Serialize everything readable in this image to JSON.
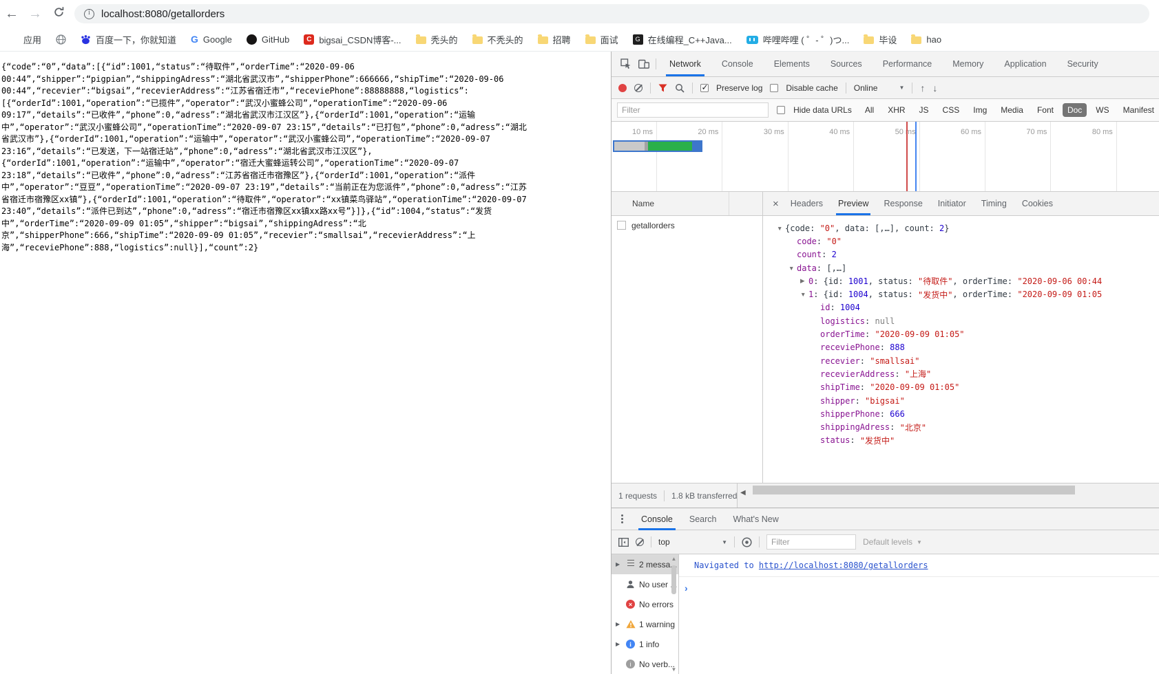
{
  "colors": {
    "accent_blue": "#1a73e8",
    "record_red": "#e04343",
    "filter_funnel_red": "#d93025",
    "waterfall_green": "#2ab04a",
    "waterfall_gray": "#c9c9c9",
    "waterfall_selection_blue": "#3d76cc",
    "timeline_marker_red": "#d04a4a",
    "timeline_marker_blue": "#4585f0",
    "json_key_purple": "#881391",
    "json_string_red": "#c41a16",
    "json_number_blue": "#1c00cf",
    "json_null_gray": "#808080",
    "console_link_blue": "#2a53cd",
    "folder_yellow": "#f8d775",
    "doc_pill_gray": "#757575"
  },
  "browser": {
    "url": "localhost:8080/getallorders",
    "bookmarks": [
      {
        "icon": "apps",
        "label": "应用"
      },
      {
        "icon": "globe",
        "label": ""
      },
      {
        "icon": "baidu",
        "label": "百度一下，你就知道"
      },
      {
        "icon": "google",
        "label": "Google"
      },
      {
        "icon": "github",
        "label": "GitHub"
      },
      {
        "icon": "csdn",
        "label": "bigsai_CSDN博客-..."
      },
      {
        "icon": "folder",
        "label": "秃头的"
      },
      {
        "icon": "folder",
        "label": "不秃头的"
      },
      {
        "icon": "folder",
        "label": "招聘"
      },
      {
        "icon": "folder",
        "label": "面试"
      },
      {
        "icon": "code-site",
        "label": "在线编程_C++Java..."
      },
      {
        "icon": "bili",
        "label": "哔哩哔哩 ( ゜- ゜)つ..."
      },
      {
        "icon": "folder",
        "label": "毕设"
      },
      {
        "icon": "folder",
        "label": "hao"
      }
    ]
  },
  "page": {
    "lines": [
      "{“code”:“0”,“data”:[{“id”:1001,“status”:“待取件”,“orderTime”:“2020-09-06",
      "00:44”,“shipper”:“pigpian”,“shippingAdress”:“湖北省武汉市”,“shipperPhone”:666666,“shipTime”:“2020-09-06",
      "00:44”,“recevier”:“bigsai”,“recevierAddress”:“江苏省宿迁市”,“receviePhone”:88888888,“logistics”:",
      "[{“orderId”:1001,“operation”:“已揽件”,“operator”:“武汉小蜜蜂公司”,“operationTime”:“2020-09-06",
      "09:17”,“details”:“已收件”,“phone”:0,“adress”:“湖北省武汉市江汉区”},{“orderId”:1001,“operation”:“运输",
      "中”,“operator”:“武汉小蜜蜂公司”,“operationTime”:“2020-09-07 23:15”,“details”:“已打包”,“phone”:0,“adress”:“湖北",
      "省武汉市”},{“orderId”:1001,“operation”:“运输中”,“operator”:“武汉小蜜蜂公司”,“operationTime”:“2020-09-07",
      "23:16”,“details”:“已发送，下一站宿迁站”,“phone”:0,“adress”:“湖北省武汉市江汉区”},",
      "{“orderId”:1001,“operation”:“运输中”,“operator”:“宿迁大蜜蜂运转公司”,“operationTime”:“2020-09-07",
      "23:18”,“details”:“已收件”,“phone”:0,“adress”:“江苏省宿迁市宿豫区”},{“orderId”:1001,“operation”:“派件",
      "中”,“operator”:“豆豆”,“operationTime”:“2020-09-07 23:19”,“details”:“当前正在为您派件”,“phone”:0,“adress”:“江苏",
      "省宿迁市宿豫区xx镇”},{“orderId”:1001,“operation”:“待取件”,“operator”:“xx镇菜鸟驿站”,“operationTime”:“2020-09-07",
      "23:40”,“details”:“派件已到达”,“phone”:0,“adress”:“宿迁市宿豫区xx镇xx路xx号”}]},{“id”:1004,“status”:“发货",
      "中”,“orderTime”:“2020-09-09 01:05”,“shipper”:“bigsai”,“shippingAdress”:“北",
      "京”,“shipperPhone”:666,“shipTime”:“2020-09-09 01:05”,“recevier”:“smallsai”,“recevierAddress”:“上",
      "海”,“receviePhone”:888,“logistics”:null}],“count”:2}"
    ]
  },
  "devtools": {
    "tabs": [
      "Network",
      "Console",
      "Elements",
      "Sources",
      "Performance",
      "Memory",
      "Application",
      "Security"
    ],
    "active_tab": "Network",
    "network": {
      "toolbar": {
        "preserve_log": "Preserve log",
        "disable_cache": "Disable cache",
        "throttling": "Online"
      },
      "filter_placeholder": "Filter",
      "hide_data_urls": "Hide data URLs",
      "filters": [
        "All",
        "XHR",
        "JS",
        "CSS",
        "Img",
        "Media",
        "Font",
        "Doc",
        "WS",
        "Manifest"
      ],
      "active_filter": "Doc",
      "timeline_ticks": [
        "10 ms",
        "20 ms",
        "30 ms",
        "40 ms",
        "50 ms",
        "60 ms",
        "70 ms",
        "80 ms"
      ],
      "name_header": "Name",
      "requests": [
        "getallorders"
      ],
      "detail_tabs": [
        "Headers",
        "Preview",
        "Response",
        "Initiator",
        "Timing",
        "Cookies"
      ],
      "active_detail_tab": "Preview",
      "status": {
        "requests": "1 requests",
        "transferred": "1.8 kB transferred"
      }
    },
    "preview_rows": [
      {
        "i": 0,
        "a": "v",
        "s": [
          [
            "{code: ",
            "p"
          ],
          [
            "\"0\"",
            "s"
          ],
          [
            ", data: ",
            "p"
          ],
          [
            "[,…]",
            "p"
          ],
          [
            ", count: ",
            "p"
          ],
          [
            "2",
            "n"
          ],
          [
            "}",
            "p"
          ]
        ]
      },
      {
        "i": 1,
        "a": null,
        "s": [
          [
            "code",
            "k"
          ],
          [
            ": ",
            "p"
          ],
          [
            "\"0\"",
            "s"
          ]
        ]
      },
      {
        "i": 1,
        "a": null,
        "s": [
          [
            "count",
            "k"
          ],
          [
            ": ",
            "p"
          ],
          [
            "2",
            "n"
          ]
        ]
      },
      {
        "i": 1,
        "a": "v",
        "s": [
          [
            "data",
            "k"
          ],
          [
            ": ",
            "p"
          ],
          [
            "[,…]",
            "p"
          ]
        ]
      },
      {
        "i": 2,
        "a": "r",
        "s": [
          [
            "0",
            "k"
          ],
          [
            ": {id: ",
            "p"
          ],
          [
            "1001",
            "n"
          ],
          [
            ", status: ",
            "p"
          ],
          [
            "\"待取件\"",
            "s"
          ],
          [
            ", orderTime: ",
            "p"
          ],
          [
            "\"2020-09-06 00:44",
            "s"
          ]
        ]
      },
      {
        "i": 2,
        "a": "v",
        "s": [
          [
            "1",
            "k"
          ],
          [
            ": {id: ",
            "p"
          ],
          [
            "1004",
            "n"
          ],
          [
            ", status: ",
            "p"
          ],
          [
            "\"发货中\"",
            "s"
          ],
          [
            ", orderTime: ",
            "p"
          ],
          [
            "\"2020-09-09 01:05",
            "s"
          ]
        ]
      },
      {
        "i": 3,
        "a": null,
        "s": [
          [
            "id",
            "k"
          ],
          [
            ": ",
            "p"
          ],
          [
            "1004",
            "n"
          ]
        ]
      },
      {
        "i": 3,
        "a": null,
        "s": [
          [
            "logistics",
            "k"
          ],
          [
            ": ",
            "p"
          ],
          [
            "null",
            "u"
          ]
        ]
      },
      {
        "i": 3,
        "a": null,
        "s": [
          [
            "orderTime",
            "k"
          ],
          [
            ": ",
            "p"
          ],
          [
            "\"2020-09-09 01:05\"",
            "s"
          ]
        ]
      },
      {
        "i": 3,
        "a": null,
        "s": [
          [
            "receviePhone",
            "k"
          ],
          [
            ": ",
            "p"
          ],
          [
            "888",
            "n"
          ]
        ]
      },
      {
        "i": 3,
        "a": null,
        "s": [
          [
            "recevier",
            "k"
          ],
          [
            ": ",
            "p"
          ],
          [
            "\"smallsai\"",
            "s"
          ]
        ]
      },
      {
        "i": 3,
        "a": null,
        "s": [
          [
            "recevierAddress",
            "k"
          ],
          [
            ": ",
            "p"
          ],
          [
            "\"上海\"",
            "s"
          ]
        ]
      },
      {
        "i": 3,
        "a": null,
        "s": [
          [
            "shipTime",
            "k"
          ],
          [
            ": ",
            "p"
          ],
          [
            "\"2020-09-09 01:05\"",
            "s"
          ]
        ]
      },
      {
        "i": 3,
        "a": null,
        "s": [
          [
            "shipper",
            "k"
          ],
          [
            ": ",
            "p"
          ],
          [
            "\"bigsai\"",
            "s"
          ]
        ]
      },
      {
        "i": 3,
        "a": null,
        "s": [
          [
            "shipperPhone",
            "k"
          ],
          [
            ": ",
            "p"
          ],
          [
            "666",
            "n"
          ]
        ]
      },
      {
        "i": 3,
        "a": null,
        "s": [
          [
            "shippingAdress",
            "k"
          ],
          [
            ": ",
            "p"
          ],
          [
            "\"北京\"",
            "s"
          ]
        ]
      },
      {
        "i": 3,
        "a": null,
        "s": [
          [
            "status",
            "k"
          ],
          [
            ": ",
            "p"
          ],
          [
            "\"发货中\"",
            "s"
          ]
        ]
      }
    ],
    "console": {
      "tabs": [
        "Console",
        "Search",
        "What's New"
      ],
      "active_tab": "Console",
      "context": "top",
      "filter_placeholder": "Filter",
      "levels": "Default levels",
      "sidebar": [
        {
          "icon": "list",
          "label": "2 messa...",
          "arrow": true,
          "selected": true
        },
        {
          "icon": "user",
          "label": "No user ...",
          "arrow": false,
          "selected": false
        },
        {
          "icon": "error",
          "label": "No errors",
          "arrow": false,
          "selected": false
        },
        {
          "icon": "warning",
          "label": "1 warning",
          "arrow": true,
          "selected": false
        },
        {
          "icon": "info",
          "label": "1 info",
          "arrow": true,
          "selected": false
        },
        {
          "icon": "verbose",
          "label": "No verb...",
          "arrow": false,
          "selected": false
        }
      ],
      "message": {
        "prefix": "Navigated to ",
        "link": "http://localhost:8080/getallorders"
      }
    }
  }
}
